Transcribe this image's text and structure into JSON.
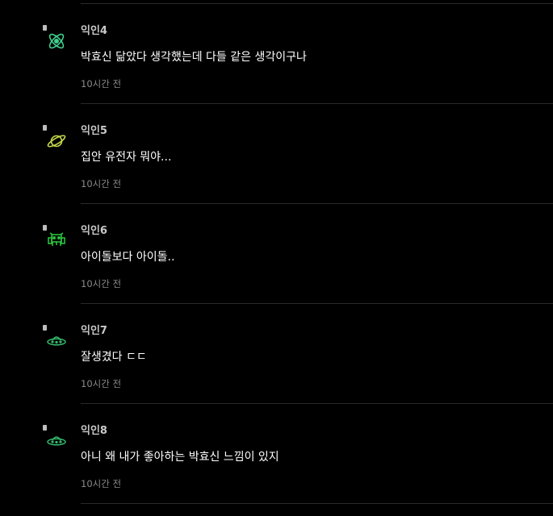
{
  "comments": [
    {
      "author": "익인4",
      "text": "박효신 닮았다 생각했는데 다들 같은 생각이구나",
      "time": "10시간 전",
      "avatar_icon": "atom-icon",
      "avatar_color": "#3fcf8e"
    },
    {
      "author": "익인5",
      "text": "집안 유전자 뭐야...",
      "time": "10시간 전",
      "avatar_icon": "planet-icon",
      "avatar_color": "#c8d94a"
    },
    {
      "author": "익인6",
      "text": "아이돌보다 아이돌..",
      "time": "10시간 전",
      "avatar_icon": "space-invader-icon",
      "avatar_color": "#2ecc40"
    },
    {
      "author": "익인7",
      "text": "잘생겼다 ㄷㄷ",
      "time": "10시간 전",
      "avatar_icon": "ufo-icon",
      "avatar_color": "#33b86b"
    },
    {
      "author": "익인8",
      "text": "아니 왜 내가 좋아하는 박효신 느낌이 있지",
      "time": "10시간 전",
      "avatar_icon": "ufo-icon",
      "avatar_color": "#33b86b"
    }
  ]
}
